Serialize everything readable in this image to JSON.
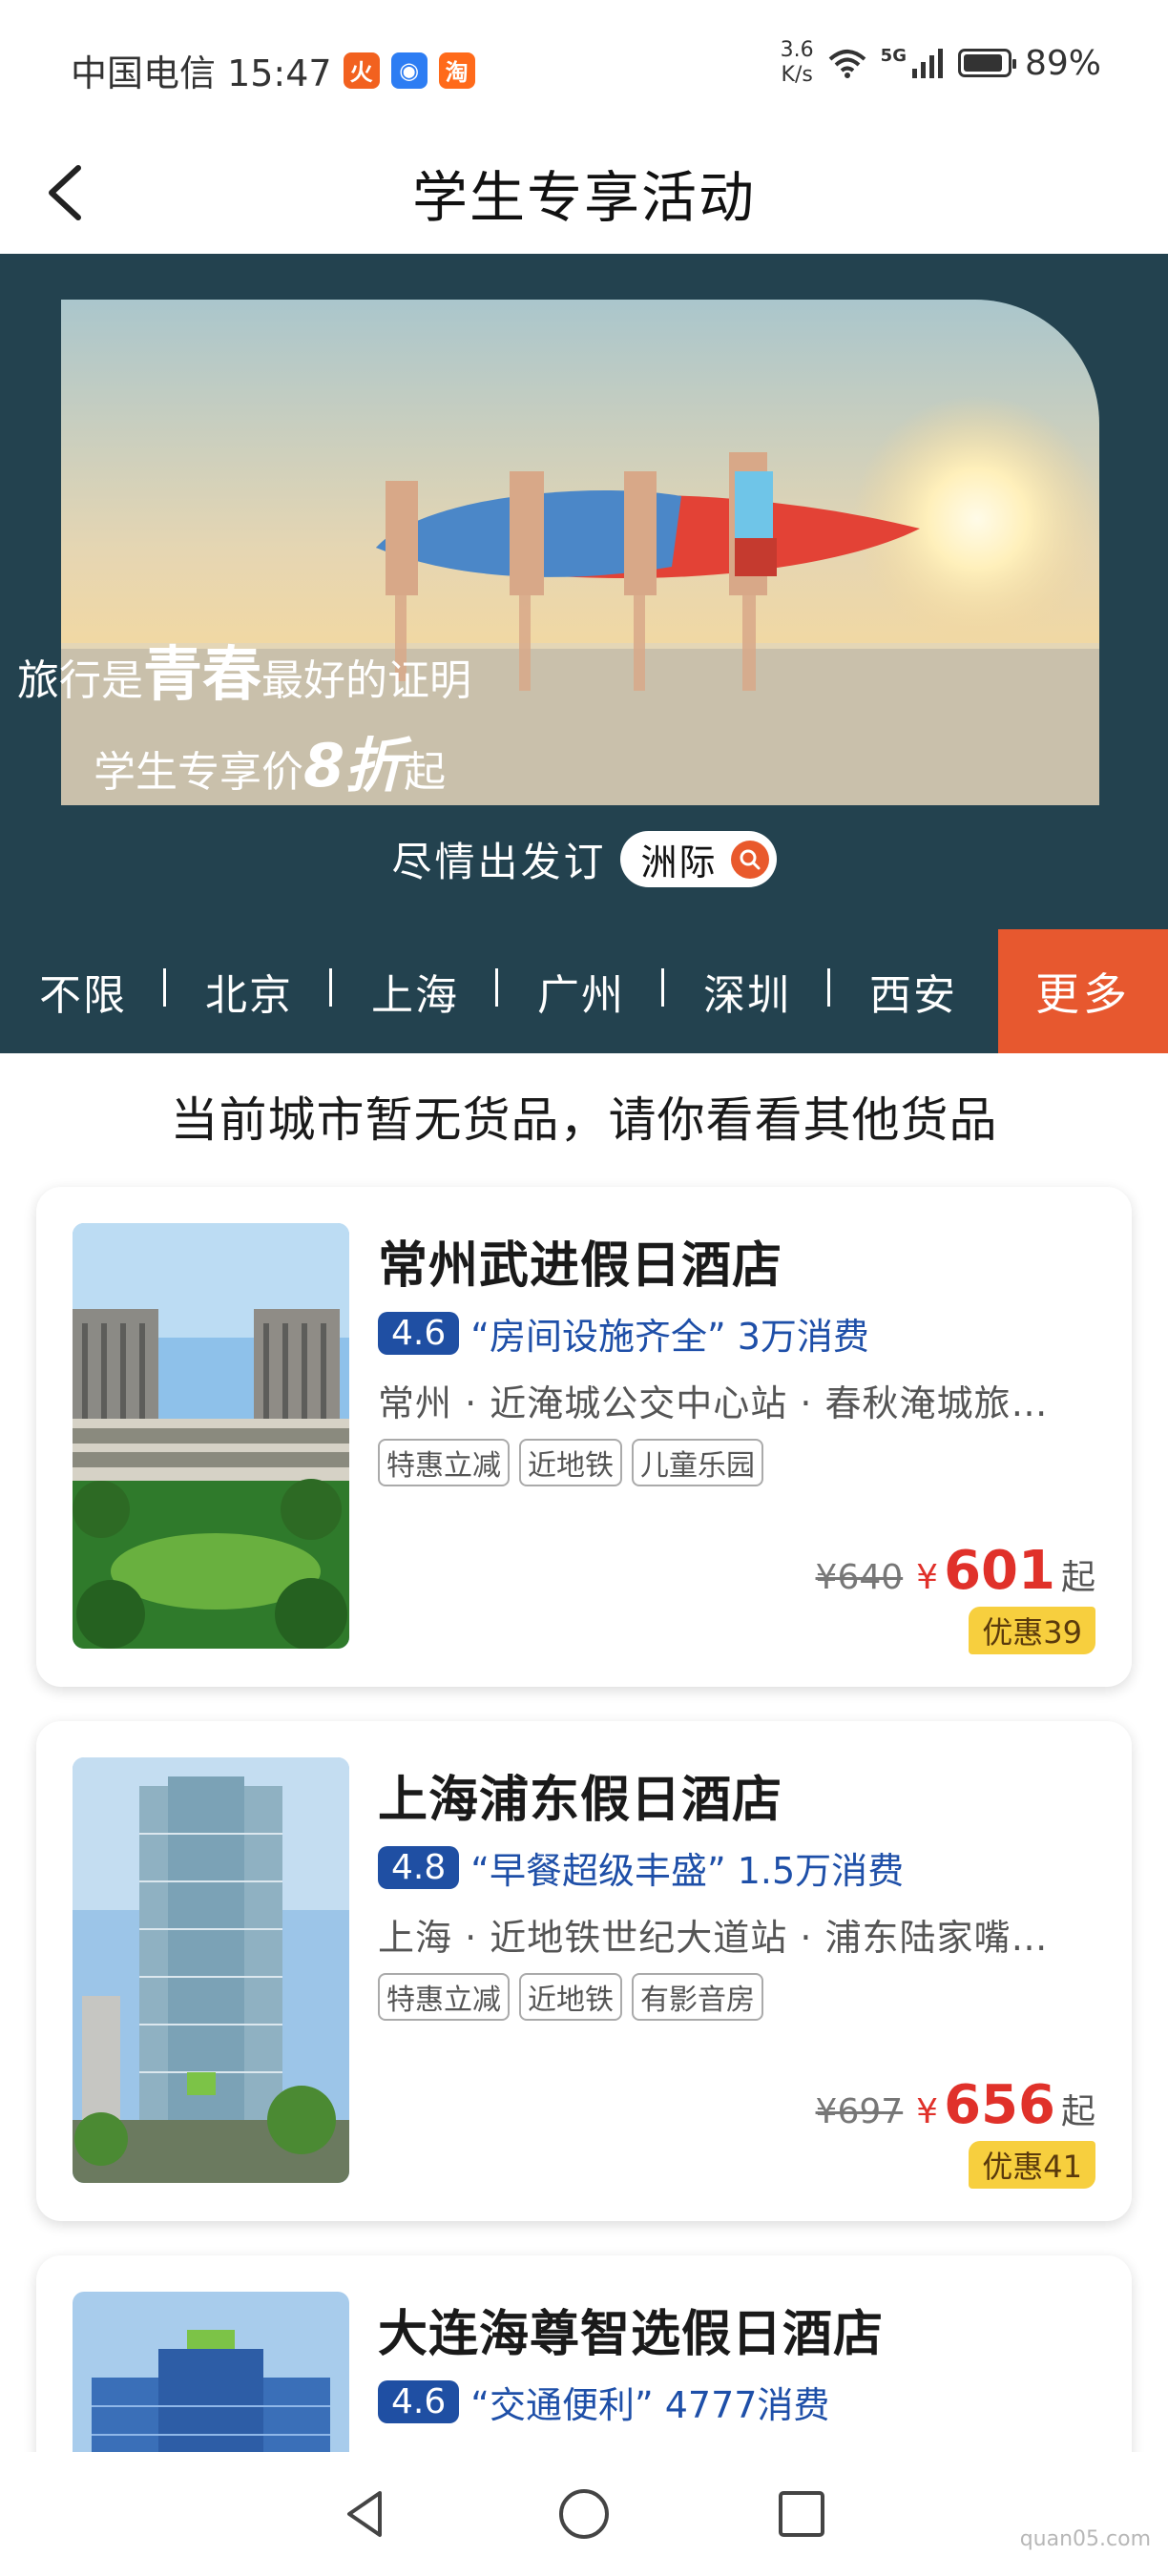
{
  "status_bar": {
    "carrier_time": "中国电信 15:47",
    "apps": [
      {
        "name": "fire-app-icon",
        "glyph": "火",
        "color": "#f2611f"
      },
      {
        "name": "robot-app-icon",
        "glyph": "◉",
        "color": "#2d7df3"
      },
      {
        "name": "taobao-app-icon",
        "glyph": "淘",
        "color": "#ff6a1a"
      }
    ],
    "net_speed_value": "3.6",
    "net_speed_unit": "K/s",
    "network_type": "5G",
    "battery": "89%"
  },
  "nav": {
    "title": "学生专享活动"
  },
  "hero": {
    "slogan_pre": "旅行是",
    "slogan_big": "青春",
    "slogan_post": "最好的证明",
    "slogan2_pre": "学生专享价",
    "slogan2_disc": "8折",
    "slogan2_post": "起",
    "cta_text": "尽情出发订",
    "cta_brand": "洲际"
  },
  "city_tabs": [
    "不限",
    "北京",
    "上海",
    "广州",
    "深圳",
    "西安"
  ],
  "more_label": "更多",
  "notice": "当前城市暂无货品，请你看看其他货品",
  "hotels": [
    {
      "name": "常州武进假日酒店",
      "rating": "4.6",
      "highlight": "“房间设施齐全” 3万消费",
      "location": "常州 · 近淹城公交中心站 · 春秋淹城旅游区",
      "tags": [
        "特惠立减",
        "近地铁",
        "儿童乐园"
      ],
      "original_price": "¥640",
      "currency": "¥",
      "price": "601",
      "suffix": "起",
      "discount": "优惠39"
    },
    {
      "name": "上海浦东假日酒店",
      "rating": "4.8",
      "highlight": "“早餐超级丰盛” 1.5万消费",
      "location": "上海 · 近地铁世纪大道站 · 浦东陆家嘴金融区",
      "tags": [
        "特惠立减",
        "近地铁",
        "有影音房"
      ],
      "original_price": "¥697",
      "currency": "¥",
      "price": "656",
      "suffix": "起",
      "discount": "优惠41"
    },
    {
      "name": "大连海尊智选假日酒店",
      "rating": "4.6",
      "highlight": "“交通便利” 4777消费"
    }
  ],
  "watermark": "quan05.com"
}
